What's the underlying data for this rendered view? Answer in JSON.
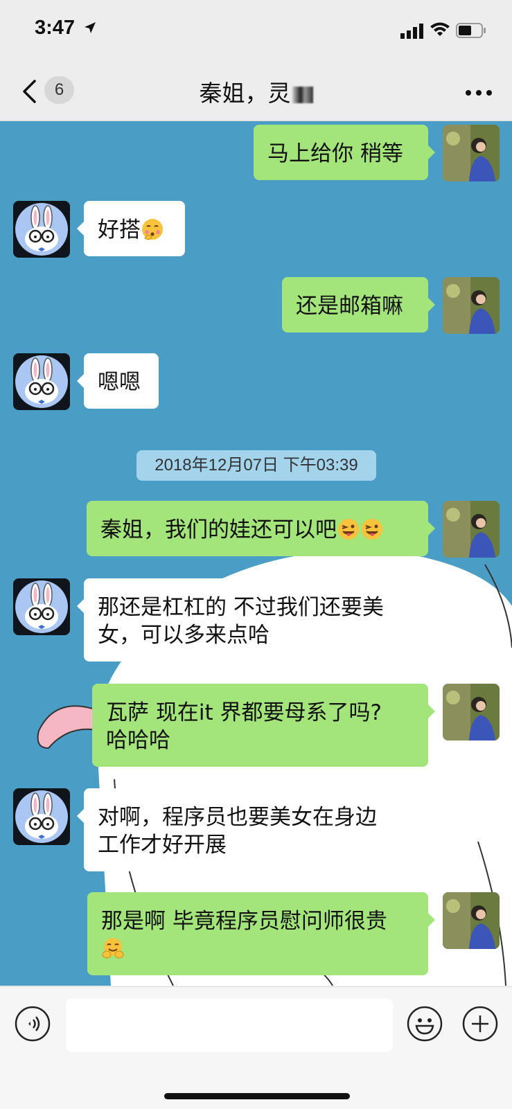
{
  "status_bar": {
    "time": "3:47",
    "icons": [
      "location-arrow-icon",
      "signal-icon",
      "wifi-icon",
      "battery-icon"
    ]
  },
  "nav": {
    "back_icon": "chevron-left-icon",
    "unread_count": "6",
    "title": "秦姐，灵",
    "more_icon": "more-dots-icon"
  },
  "messages": [
    {
      "side": "out",
      "text": "马上给你 稍等"
    },
    {
      "side": "in",
      "text": "好搭",
      "emoji": "face-blowing-kiss"
    },
    {
      "side": "out",
      "text": "还是邮箱嘛"
    },
    {
      "side": "in",
      "text": "嗯嗯"
    },
    {
      "side": "out",
      "text": "秦姐，我们的娃还可以吧",
      "emoji": "winking-face-with-tongue x2"
    },
    {
      "side": "in",
      "text": "那还是杠杠的 不过我们还要美女，可以多来点哈"
    },
    {
      "side": "out",
      "text": "瓦萨 现在it 界都要母系了吗?哈哈哈"
    },
    {
      "side": "in",
      "text": "对啊，程序员也要美女在身边工作才好开展"
    },
    {
      "side": "out",
      "text": "那是啊 毕竟程序员慰问师很贵",
      "emoji": "hugging-face"
    }
  ],
  "msg1": {
    "line1": "马上给你 稍等"
  },
  "msg2": {
    "line1": "好搭"
  },
  "msg3": {
    "line1": "还是邮箱嘛"
  },
  "msg4": {
    "line1": "嗯嗯"
  },
  "timestamp": "2018年12月07日 下午03:39",
  "msg5": {
    "line1": "秦姐，我们的娃还可以吧"
  },
  "msg6": {
    "line1": "那还是杠杠的 不过我们还要美",
    "line2": "女，可以多来点哈"
  },
  "msg7": {
    "line1": "瓦萨 现在it 界都要母系了吗?",
    "line2": "哈哈哈"
  },
  "msg8": {
    "line1": "对啊，程序员也要美女在身边",
    "line2": "工作才好开展"
  },
  "msg9": {
    "line1": "那是啊 毕竟程序员慰问师很贵"
  },
  "input_bar": {
    "voice_icon": "voice-input-icon",
    "input_value": "",
    "emoji_icon": "emoji-smile-icon",
    "plus_icon": "plus-circle-icon"
  },
  "colors": {
    "chat_background": "#4a9dc4",
    "outgoing_bubble": "#a4e57b",
    "incoming_bubble": "#ffffff",
    "timestamp_pill": "#a3d4ec"
  }
}
